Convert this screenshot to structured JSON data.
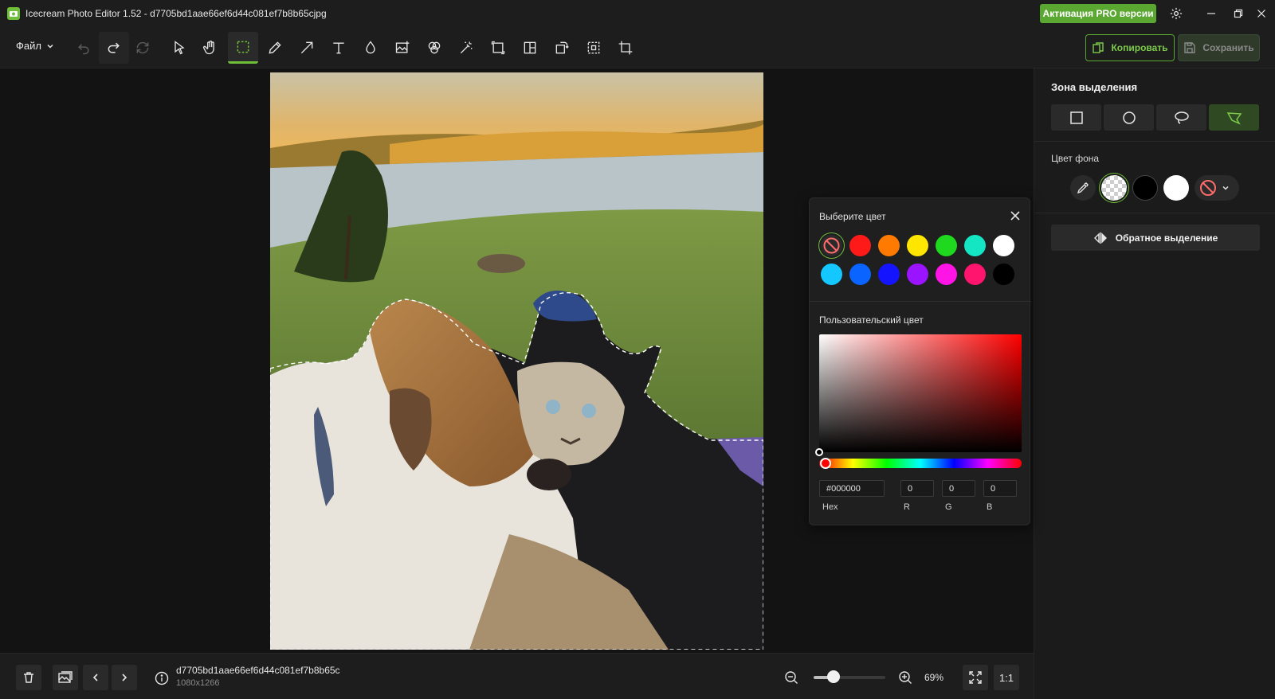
{
  "window": {
    "title": "Icecream Photo Editor 1.52 - d7705bd1aae66ef6d44c081ef7b8b65cjpg",
    "pro_button": "Активация PRO версии"
  },
  "toolbar": {
    "file_menu": "Файл",
    "copy_label": "Копировать",
    "save_label": "Сохранить",
    "tools": [
      "undo-icon",
      "redo-icon",
      "reset-icon",
      "select-icon",
      "hand-icon",
      "selection-icon",
      "pencil-icon",
      "arrow-icon",
      "text-icon",
      "drop-icon",
      "image-icon",
      "effects-icon",
      "magic-wand-icon",
      "resize-icon",
      "layout-icon",
      "rotate-icon",
      "crop-frame-icon",
      "crop-icon"
    ]
  },
  "sidebar": {
    "title": "Зона выделения",
    "bg_color_label": "Цвет фона",
    "invert_label": "Обратное выделение"
  },
  "color_picker": {
    "title": "Выберите цвет",
    "custom_label": "Пользовательский цвет",
    "swatches_row1": [
      "none",
      "#ff1a1a",
      "#ff7a00",
      "#ffe600",
      "#1ed91e",
      "#14e6c3",
      "#ffffff"
    ],
    "swatches_row2": [
      "#14c8ff",
      "#0a64ff",
      "#1414ff",
      "#9b14ff",
      "#ff14e6",
      "#ff146e",
      "#000000"
    ],
    "hex_value": "#000000",
    "r": "0",
    "g": "0",
    "b": "0",
    "hex_label": "Hex",
    "r_label": "R",
    "g_label": "G",
    "b_label": "B"
  },
  "bottombar": {
    "file_name": "d7705bd1aae66ef6d44c081ef7b8b65c",
    "dimensions": "1080x1266",
    "zoom": "69%",
    "zoom_fraction": 0.28,
    "one_to_one": "1:1"
  },
  "colors": {
    "accent": "#6fbf3a"
  }
}
